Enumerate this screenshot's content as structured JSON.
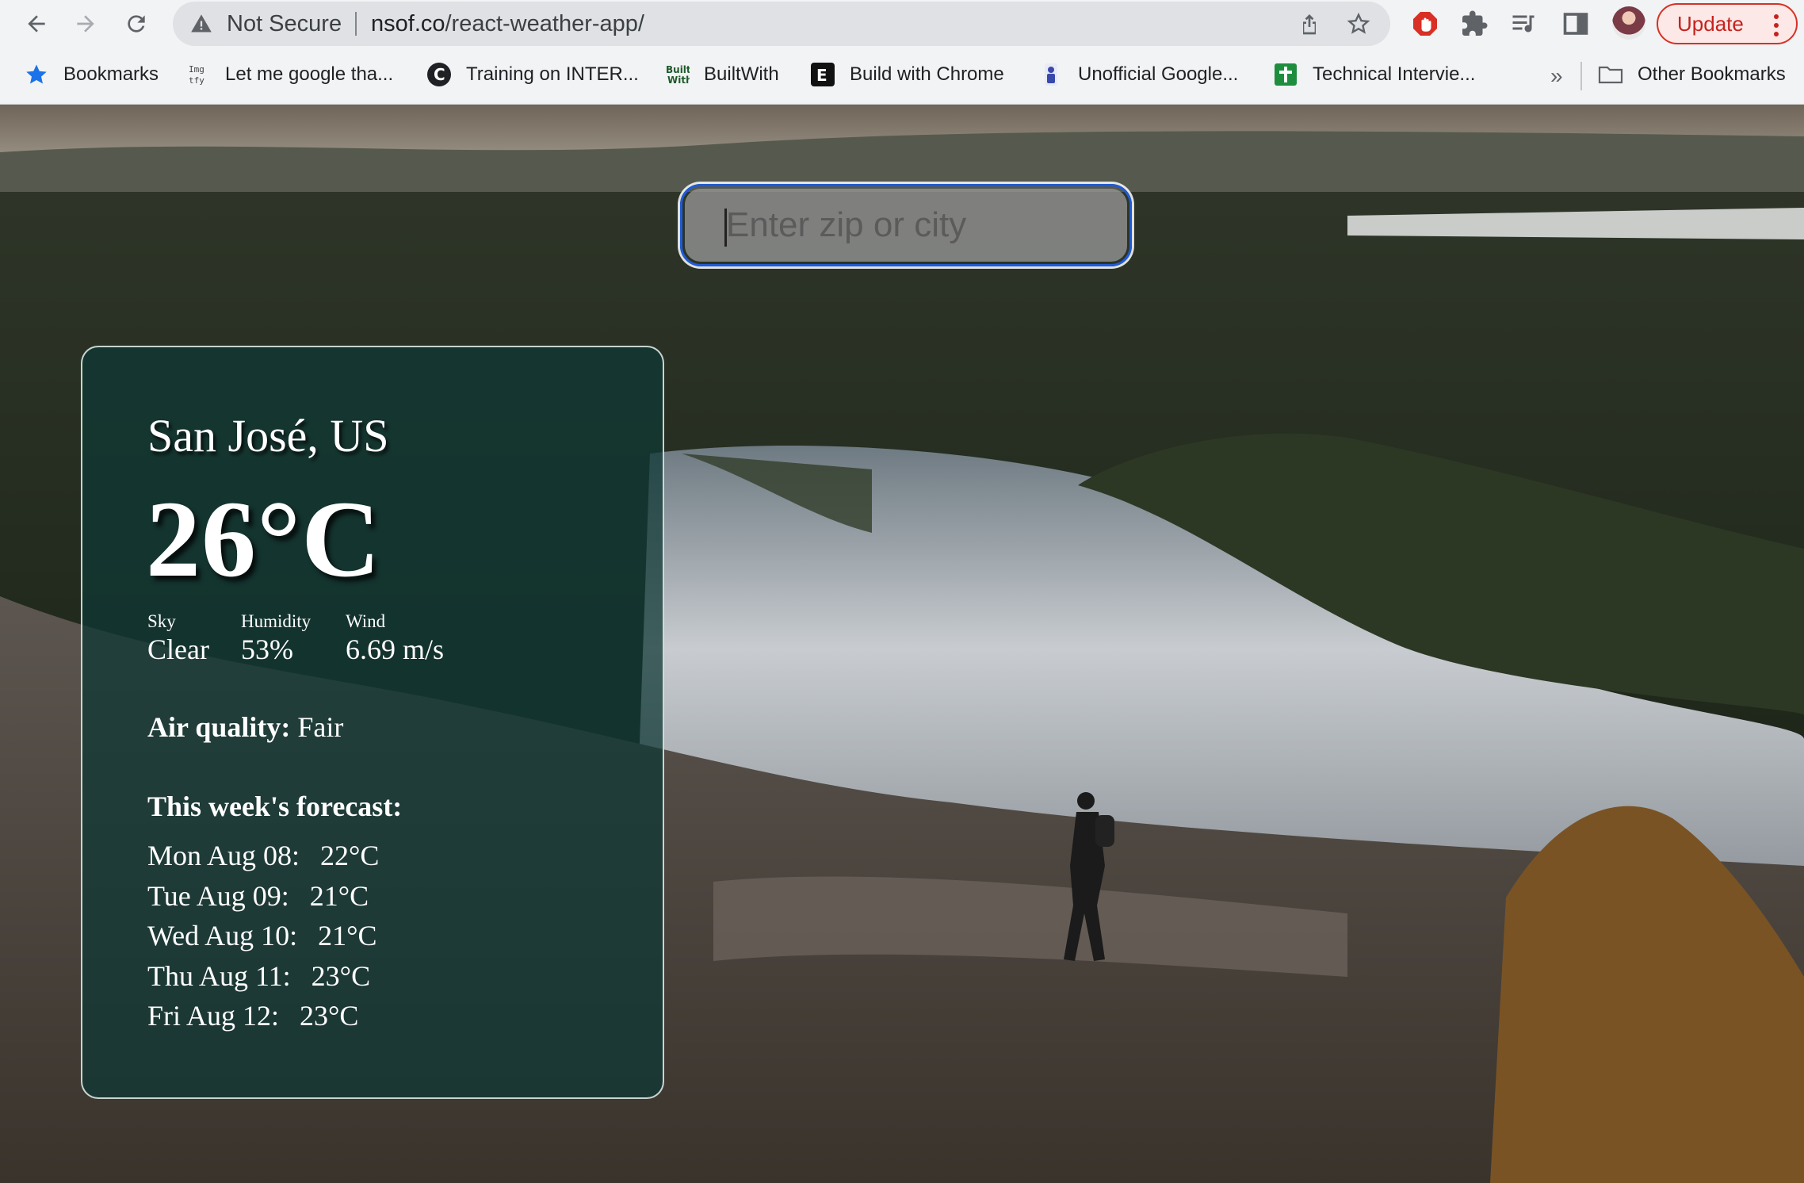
{
  "browser": {
    "security_label": "Not Secure",
    "url_host": "nsof.co",
    "url_path": "/react-weather-app/",
    "update_label": "Update",
    "more_bookmarks": "»"
  },
  "bookmarks": [
    {
      "label": "Bookmarks",
      "icon": "star-icon"
    },
    {
      "label": "Let me google tha...",
      "icon": "lmgtfy-icon"
    },
    {
      "label": "Training on INTER...",
      "icon": "c-logo-icon"
    },
    {
      "label": "BuiltWith",
      "icon": "builtwith-icon"
    },
    {
      "label": "Build with Chrome",
      "icon": "e-logo-icon"
    },
    {
      "label": "Unofficial Google...",
      "icon": "bookmark-icon"
    },
    {
      "label": "Technical Intervie...",
      "icon": "sheets-icon"
    },
    {
      "label": "Other Bookmarks",
      "icon": "folder-icon"
    }
  ],
  "search": {
    "placeholder": "Enter zip or city",
    "value": ""
  },
  "weather": {
    "city": "San José, US",
    "temperature": "26°C",
    "stats": [
      {
        "label": "Sky",
        "value": "Clear"
      },
      {
        "label": "Humidity",
        "value": "53%"
      },
      {
        "label": "Wind",
        "value": "6.69 m/s"
      }
    ],
    "air_quality_label": "Air quality:",
    "air_quality_value": "Fair",
    "forecast_title": "This week's forecast:",
    "forecast": [
      {
        "day": "Mon Aug 08:",
        "temp": "22°C"
      },
      {
        "day": "Tue Aug 09:",
        "temp": "21°C"
      },
      {
        "day": "Wed Aug 10:",
        "temp": "21°C"
      },
      {
        "day": "Thu Aug 11:",
        "temp": "23°C"
      },
      {
        "day": "Fri Aug 12:",
        "temp": "23°C"
      }
    ]
  },
  "colors": {
    "accent": "#1f5bd6",
    "card": "#0f3734",
    "update": "#d93025"
  }
}
